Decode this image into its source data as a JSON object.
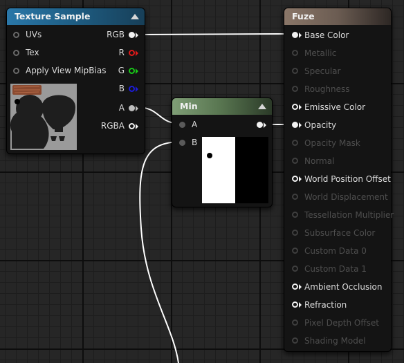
{
  "texture_sample": {
    "title": "Texture Sample",
    "inputs": [
      "UVs",
      "Tex",
      "Apply View MipBias"
    ],
    "outputs": [
      "RGB",
      "R",
      "G",
      "B",
      "A",
      "RGBA"
    ]
  },
  "min_node": {
    "title": "Min",
    "inputs": [
      "A",
      "B"
    ]
  },
  "fuze": {
    "title": "Fuze",
    "pins": [
      {
        "label": "Base Color",
        "active": true
      },
      {
        "label": "Metallic",
        "active": false
      },
      {
        "label": "Specular",
        "active": false
      },
      {
        "label": "Roughness",
        "active": false
      },
      {
        "label": "Emissive Color",
        "active": true
      },
      {
        "label": "Opacity",
        "active": true
      },
      {
        "label": "Opacity Mask",
        "active": false
      },
      {
        "label": "Normal",
        "active": false
      },
      {
        "label": "World Position Offset",
        "active": true
      },
      {
        "label": "World Displacement",
        "active": false
      },
      {
        "label": "Tessellation Multiplier",
        "active": false
      },
      {
        "label": "Subsurface Color",
        "active": false
      },
      {
        "label": "Custom Data 0",
        "active": false
      },
      {
        "label": "Custom Data 1",
        "active": false
      },
      {
        "label": "Ambient Occlusion",
        "active": true
      },
      {
        "label": "Refraction",
        "active": true
      },
      {
        "label": "Pixel Depth Offset",
        "active": false
      },
      {
        "label": "Shading Model",
        "active": false
      }
    ]
  },
  "colors": {
    "texture_header": "#1f5f86",
    "min_header": "#6e8c66",
    "fuze_header": "#7c6a5e",
    "wire": "#ffffff"
  }
}
